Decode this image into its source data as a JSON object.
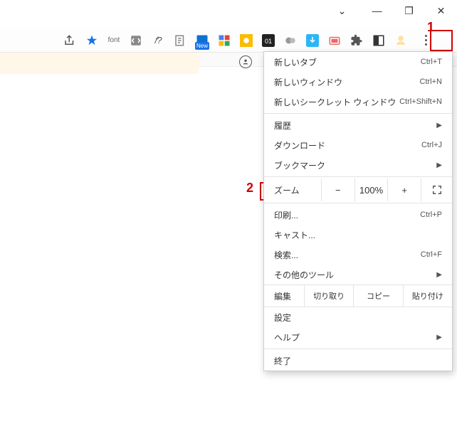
{
  "annotations": {
    "one": "1",
    "two": "2"
  },
  "window": {
    "chevron": "⌄",
    "min": "—",
    "max": "❐",
    "close": "✕"
  },
  "toolbar": {
    "font": "font",
    "f": "𝑓?",
    "new": "New",
    "z01": "01"
  },
  "menu": {
    "new_tab": "新しいタブ",
    "new_tab_sc": "Ctrl+T",
    "new_window": "新しいウィンドウ",
    "new_window_sc": "Ctrl+N",
    "incognito": "新しいシークレット ウィンドウ",
    "incognito_sc": "Ctrl+Shift+N",
    "history": "履歴",
    "downloads": "ダウンロード",
    "downloads_sc": "Ctrl+J",
    "bookmarks": "ブックマーク",
    "zoom": "ズーム",
    "zoom_minus": "−",
    "zoom_val": "100%",
    "zoom_plus": "+",
    "print": "印刷...",
    "print_sc": "Ctrl+P",
    "cast": "キャスト...",
    "find": "検索...",
    "find_sc": "Ctrl+F",
    "more_tools": "その他のツール",
    "edit": "編集",
    "cut": "切り取り",
    "copy": "コピー",
    "paste": "貼り付け",
    "settings": "設定",
    "help": "ヘルプ",
    "exit": "終了"
  }
}
